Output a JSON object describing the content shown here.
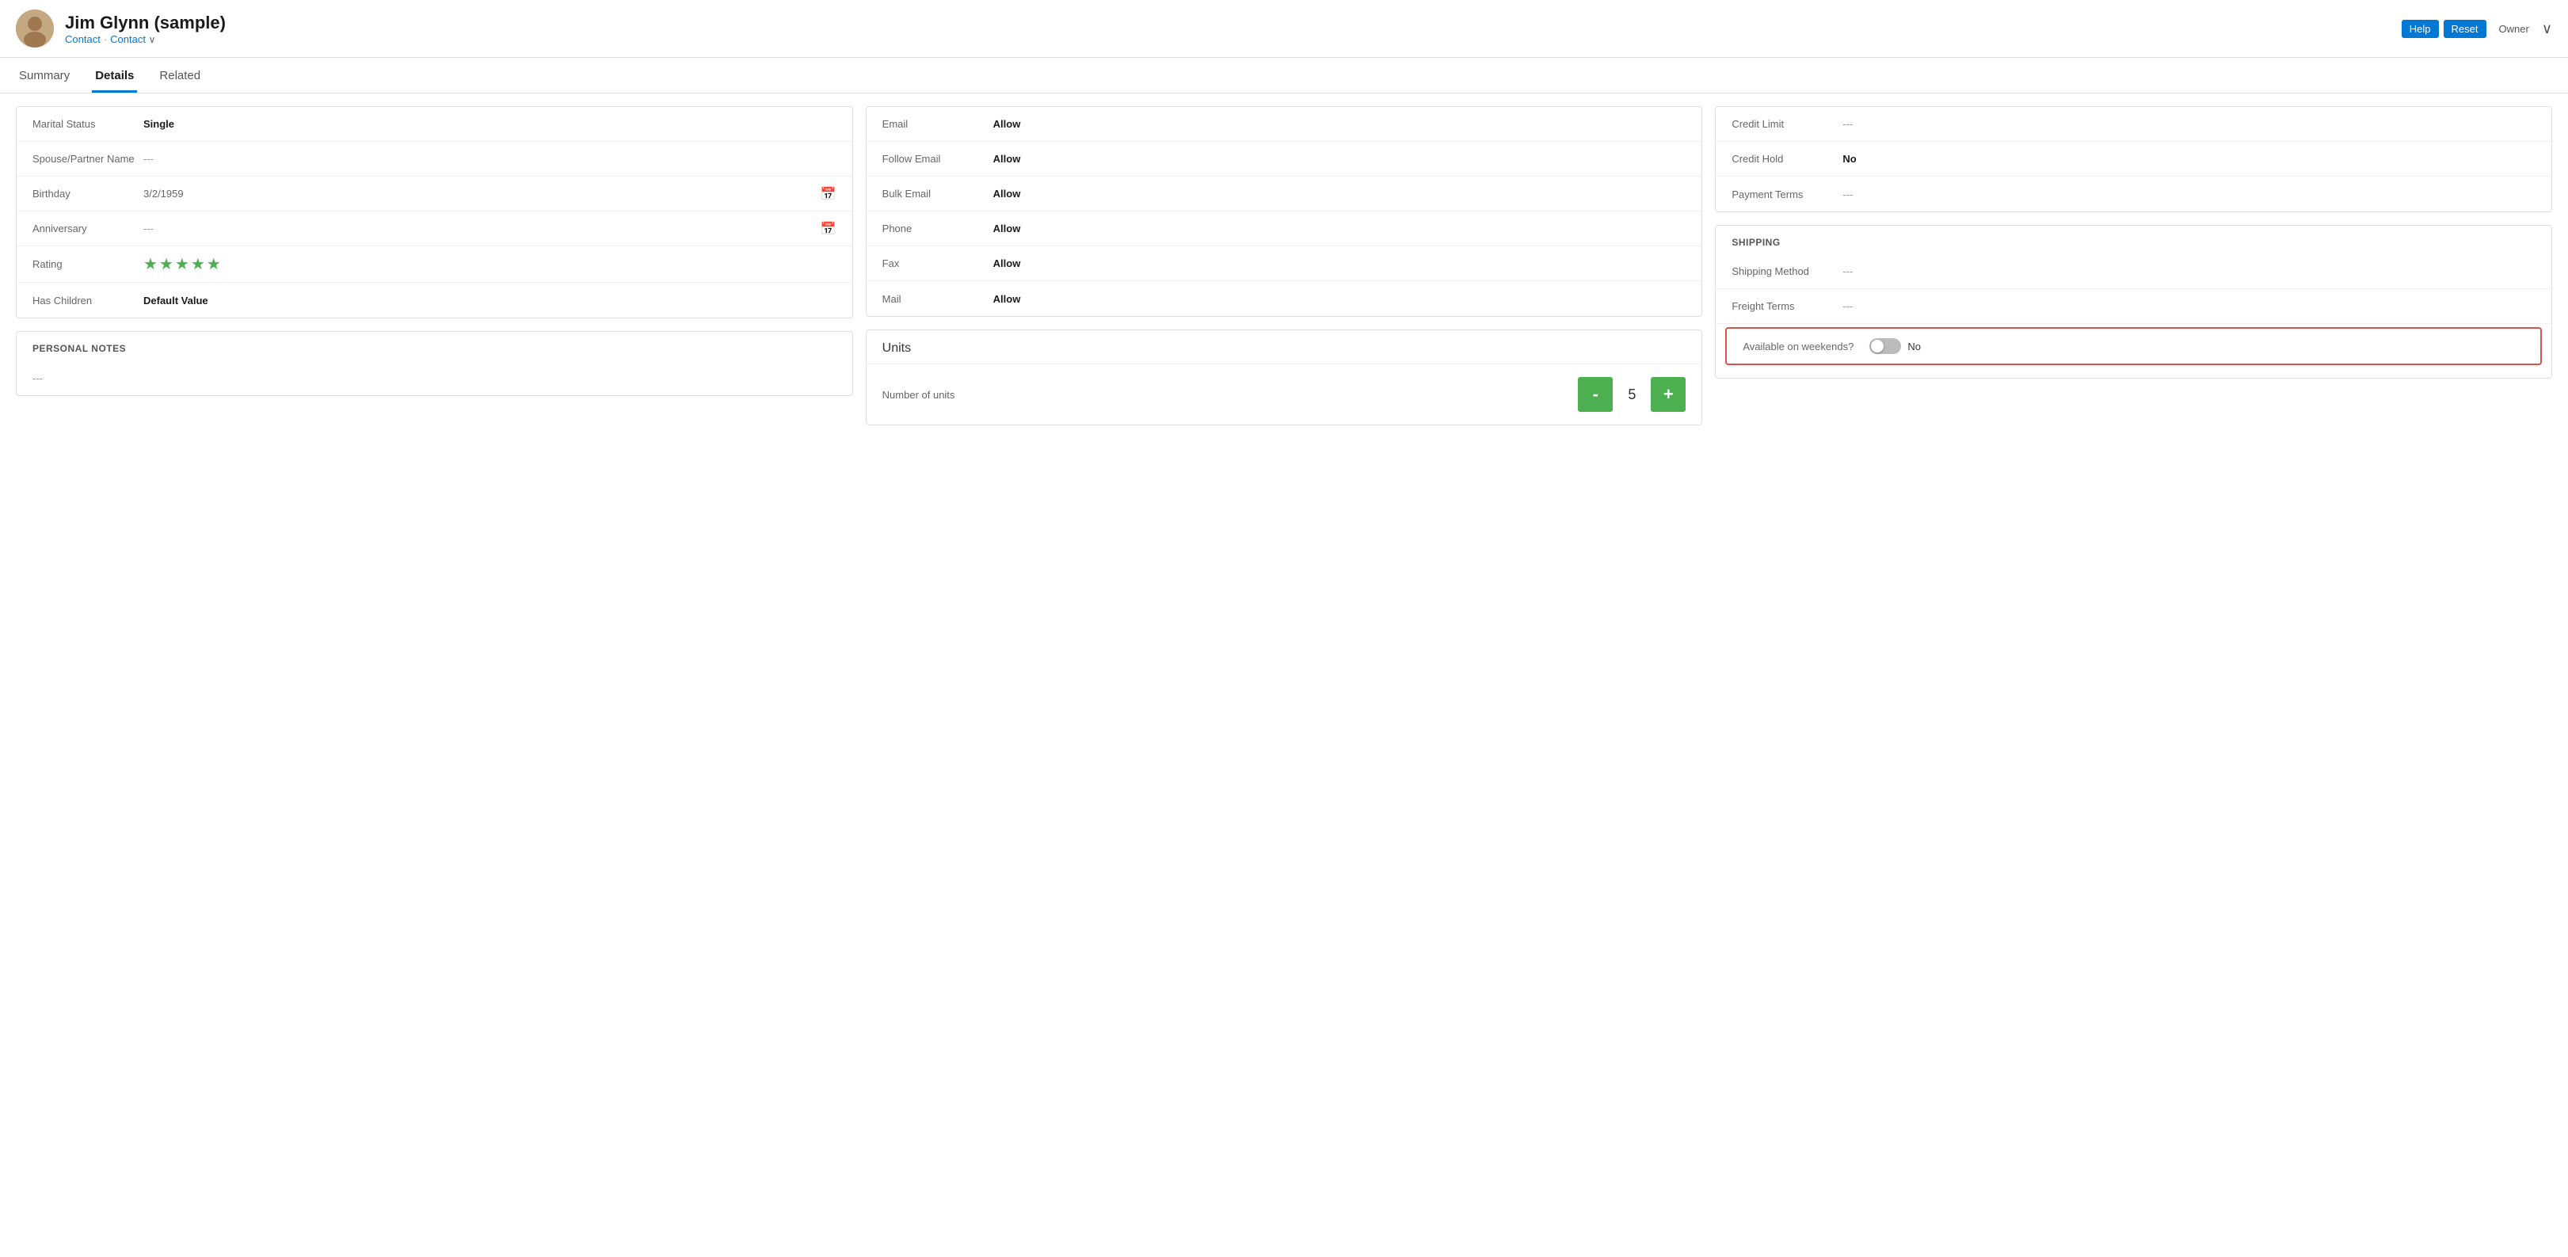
{
  "header": {
    "name": "Jim Glynn (sample)",
    "type1": "Contact",
    "separator": "·",
    "type2": "Contact",
    "owner_label": "Owner",
    "help_label": "Help",
    "reset_label": "Reset"
  },
  "tabs": [
    {
      "id": "summary",
      "label": "Summary",
      "active": false
    },
    {
      "id": "details",
      "label": "Details",
      "active": true
    },
    {
      "id": "related",
      "label": "Related",
      "active": false
    }
  ],
  "personal_info": {
    "section_fields": [
      {
        "label": "Marital Status",
        "value": "Single",
        "style": "bold"
      },
      {
        "label": "Spouse/Partner Name",
        "value": "---",
        "style": "dashes"
      },
      {
        "label": "Birthday",
        "value": "3/2/1959",
        "style": "normal",
        "has_calendar": true
      },
      {
        "label": "Anniversary",
        "value": "---",
        "style": "dashes",
        "has_calendar": true
      },
      {
        "label": "Rating",
        "value": "stars",
        "stars": 5
      },
      {
        "label": "Has Children",
        "value": "Default Value",
        "style": "bold"
      }
    ]
  },
  "personal_notes": {
    "title": "PERSONAL NOTES",
    "value": "---"
  },
  "contact_preferences": {
    "fields": [
      {
        "label": "Email",
        "value": "Allow",
        "style": "bold"
      },
      {
        "label": "Follow Email",
        "value": "Allow",
        "style": "bold"
      },
      {
        "label": "Bulk Email",
        "value": "Allow",
        "style": "bold"
      },
      {
        "label": "Phone",
        "value": "Allow",
        "style": "bold"
      },
      {
        "label": "Fax",
        "value": "Allow",
        "style": "bold"
      },
      {
        "label": "Mail",
        "value": "Allow",
        "style": "bold"
      }
    ]
  },
  "units": {
    "title": "Units",
    "label": "Number of units",
    "value": "5",
    "minus_label": "-",
    "plus_label": "+"
  },
  "billing": {
    "fields": [
      {
        "label": "Credit Limit",
        "value": "---",
        "style": "dashes"
      },
      {
        "label": "Credit Hold",
        "value": "No",
        "style": "bold"
      },
      {
        "label": "Payment Terms",
        "value": "---",
        "style": "dashes"
      }
    ]
  },
  "shipping": {
    "title": "SHIPPING",
    "fields": [
      {
        "label": "Shipping Method",
        "value": "---",
        "style": "dashes"
      },
      {
        "label": "Freight Terms",
        "value": "---",
        "style": "dashes"
      }
    ],
    "weekends_label": "Available on weekends?",
    "weekends_value": "No",
    "weekends_toggle": false
  }
}
